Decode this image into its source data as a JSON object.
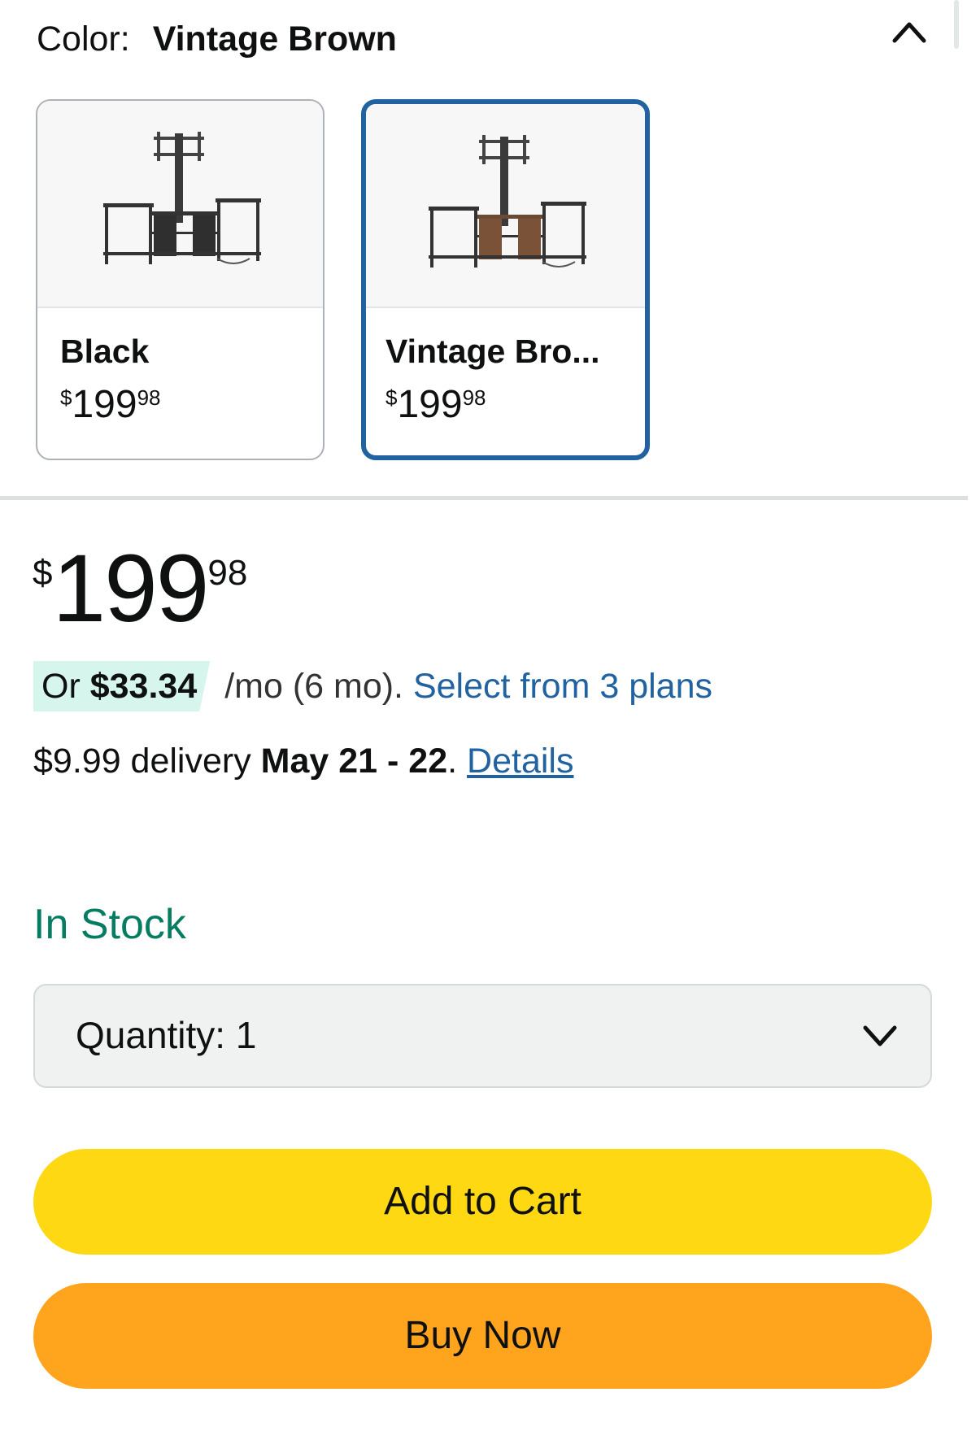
{
  "color_selector": {
    "label": "Color:",
    "selected_value": "Vintage Brown",
    "collapse_icon": "chevron-up-icon",
    "options": [
      {
        "name": "Black",
        "price_currency": "$",
        "price_whole": "199",
        "price_fraction": "98",
        "selected": false
      },
      {
        "name": "Vintage Bro...",
        "price_currency": "$",
        "price_whole": "199",
        "price_fraction": "98",
        "selected": true
      }
    ]
  },
  "price": {
    "currency": "$",
    "whole": "199",
    "fraction": "98"
  },
  "financing": {
    "prefix": "Or ",
    "amount": "$33.34",
    "term": " /mo (6 mo). ",
    "link": "Select from 3 plans"
  },
  "delivery": {
    "cost": "$9.99 delivery ",
    "dates": "May 21 - 22",
    "period": ". ",
    "details_link": "Details"
  },
  "stock_status": "In Stock",
  "quantity": {
    "label": "Quantity:",
    "value": "1",
    "icon": "chevron-down-icon"
  },
  "buttons": {
    "add_to_cart": "Add to Cart",
    "buy_now": "Buy Now"
  },
  "colors": {
    "selected_border": "#2162a1",
    "link": "#2162a1",
    "in_stock": "#067d62",
    "add_to_cart_bg": "#ffd814",
    "buy_now_bg": "#ffa41c",
    "financing_badge_bg": "#d6f5ec"
  }
}
